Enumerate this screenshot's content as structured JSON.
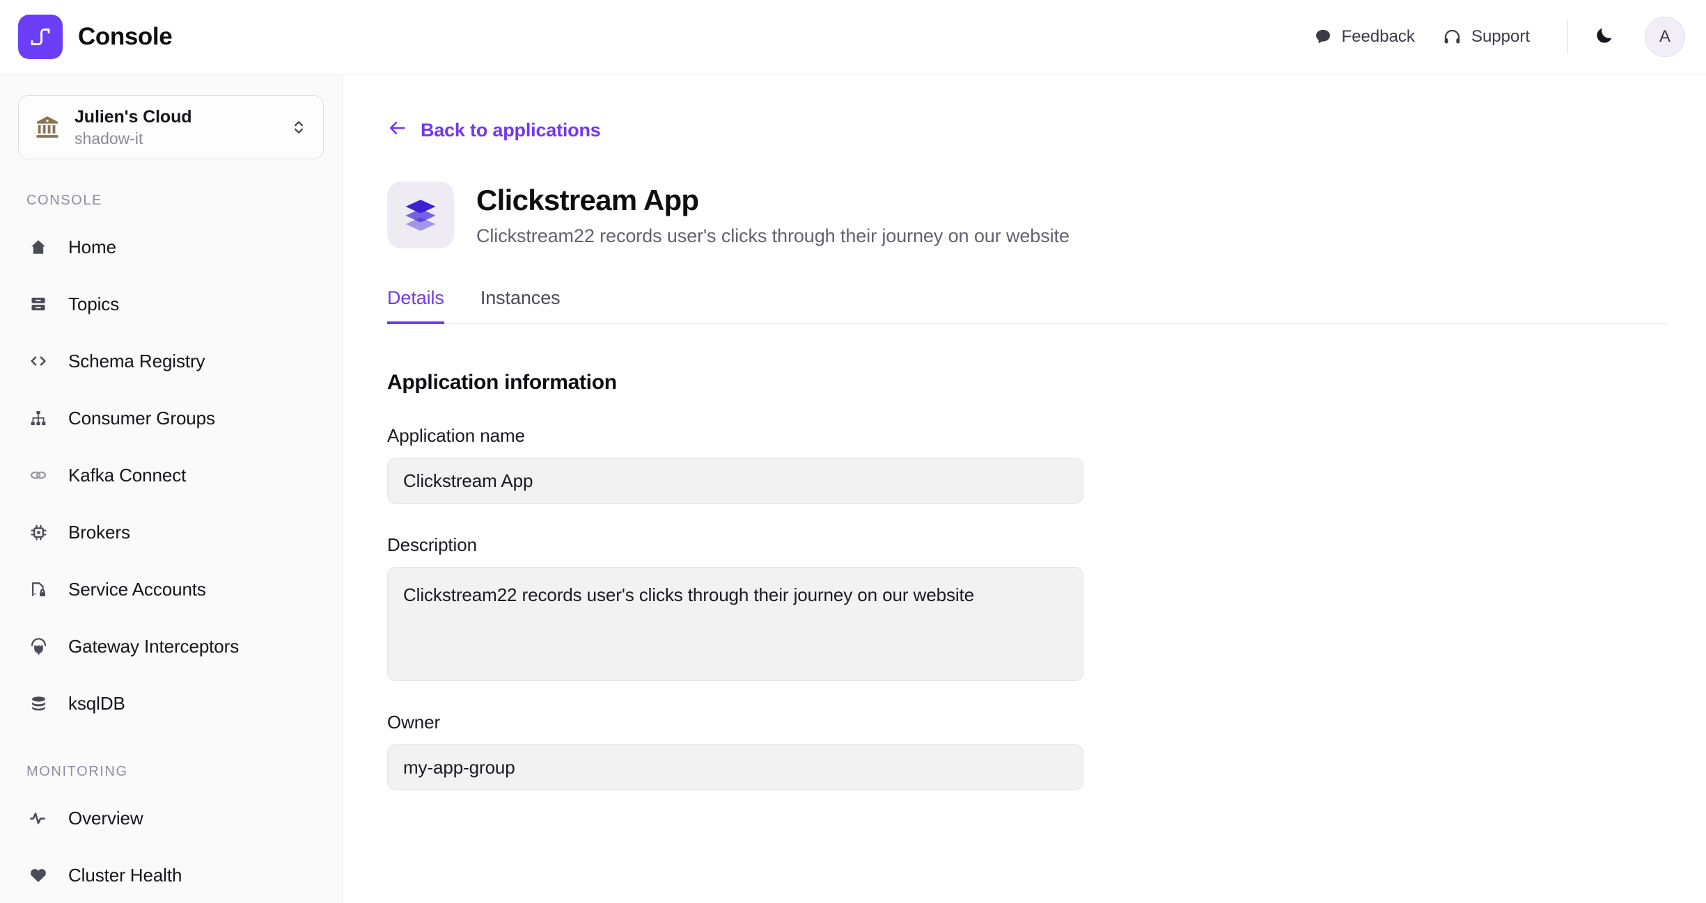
{
  "header": {
    "brand_title": "Console",
    "logo_icon": "conduktor-fork-icon",
    "actions": [
      {
        "label": "Feedback",
        "icon": "chat-bubble-icon"
      },
      {
        "label": "Support",
        "icon": "headphones-icon"
      }
    ],
    "theme_toggle_icon": "moon-icon",
    "avatar_initial": "A"
  },
  "sidebar": {
    "org": {
      "name": "Julien's Cloud",
      "subtitle": "shadow-it",
      "icon": "bank-building-icon",
      "caret_icon": "chevron-up-down-icon"
    },
    "sections": [
      {
        "label": "CONSOLE",
        "items": [
          {
            "label": "Home",
            "icon": "home-icon"
          },
          {
            "label": "Topics",
            "icon": "topics-stack-icon"
          },
          {
            "label": "Schema Registry",
            "icon": "code-brackets-icon"
          },
          {
            "label": "Consumer Groups",
            "icon": "org-tree-icon"
          },
          {
            "label": "Kafka Connect",
            "icon": "link-chain-icon"
          },
          {
            "label": "Brokers",
            "icon": "cpu-chip-icon"
          },
          {
            "label": "Service Accounts",
            "icon": "document-lock-icon"
          },
          {
            "label": "Gateway Interceptors",
            "icon": "plug-icon"
          },
          {
            "label": "ksqlDB",
            "icon": "database-icon"
          }
        ]
      },
      {
        "label": "MONITORING",
        "items": [
          {
            "label": "Overview",
            "icon": "pulse-activity-icon"
          },
          {
            "label": "Cluster Health",
            "icon": "heart-icon"
          }
        ]
      }
    ]
  },
  "main": {
    "back_link": {
      "label": "Back to applications",
      "icon": "arrow-left-icon"
    },
    "app": {
      "icon": "layers-stack-icon",
      "title": "Clickstream App",
      "description": "Clickstream22 records user's clicks through their journey on our website"
    },
    "tabs": [
      {
        "label": "Details",
        "active": true
      },
      {
        "label": "Instances",
        "active": false
      }
    ],
    "section_title": "Application information",
    "fields": [
      {
        "label": "Application name",
        "value": "Clickstream App",
        "type": "input"
      },
      {
        "label": "Description",
        "value": "Clickstream22 records user's clicks through their journey on our website",
        "type": "textarea"
      },
      {
        "label": "Owner",
        "value": "my-app-group",
        "type": "input"
      }
    ]
  },
  "colors": {
    "accent": "#7338f0",
    "brand_logo_bg": "#6d3ef7",
    "app_icon_bg": "#eeebf5",
    "app_icon_diamond": "#3a21d6",
    "sidebar_bg": "#fafafb",
    "field_bg": "#f2f2f3",
    "org_icon": "#8a7550"
  }
}
